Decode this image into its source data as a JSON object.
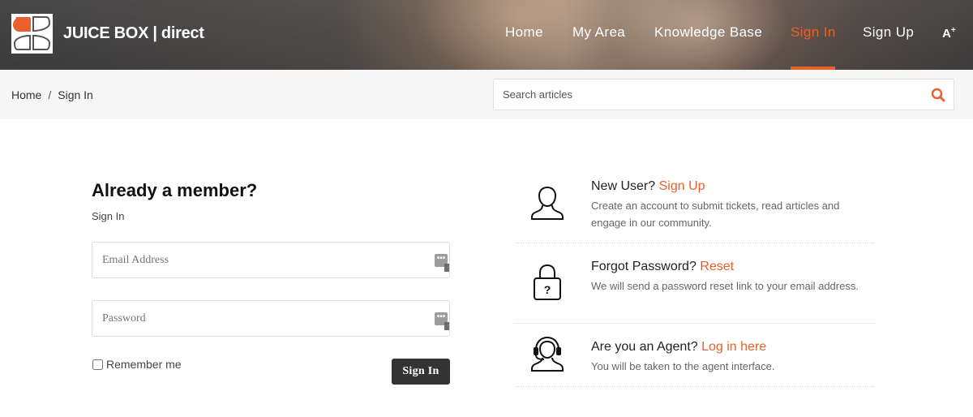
{
  "brand": {
    "name": "JUICE BOX | direct",
    "accent": "#e8612c"
  },
  "nav": {
    "items": [
      {
        "label": "Home"
      },
      {
        "label": "My Area"
      },
      {
        "label": "Knowledge Base"
      },
      {
        "label": "Sign In",
        "active": true
      },
      {
        "label": "Sign Up"
      }
    ],
    "font_toggle": "A",
    "font_toggle_sup": "+"
  },
  "breadcrumb": {
    "home": "Home",
    "separator": "/",
    "current": "Sign In"
  },
  "search": {
    "placeholder": "Search articles",
    "value": "",
    "icon": "search-icon"
  },
  "login": {
    "title": "Already a member?",
    "subtitle": "Sign In",
    "email_placeholder": "Email Address",
    "password_placeholder": "Password",
    "remember_label": "Remember me",
    "remember_checked": false,
    "submit_label": "Sign In"
  },
  "info": {
    "new_user": {
      "icon": "user-icon",
      "question": "New User?",
      "link": "Sign Up",
      "description": "Create an account to submit tickets, read articles and engage in our community."
    },
    "forgot": {
      "icon": "lock-question-icon",
      "question": "Forgot Password?",
      "link": "Reset",
      "description": "We will send a password reset link to your email address."
    },
    "agent": {
      "icon": "headset-agent-icon",
      "question": "Are you an Agent?",
      "link": "Log in here",
      "description": "You will be taken to the agent interface."
    }
  }
}
